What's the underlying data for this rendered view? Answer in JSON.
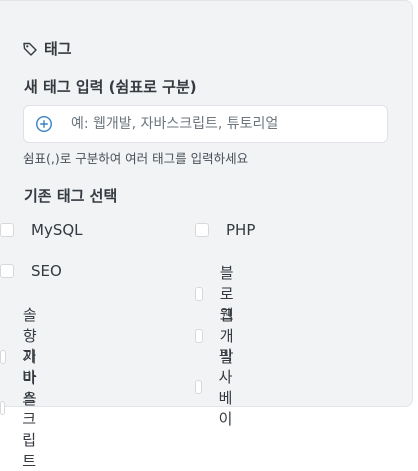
{
  "panel": {
    "title": "태그",
    "title_icon": "tag-icon"
  },
  "new_tag": {
    "label": "새 태그 입력 (쉼표로 구분)",
    "placeholder": "예: 웹개발, 자바스크립트, 튜토리얼",
    "value": "",
    "add_icon": "plus-circle-icon",
    "help": "쉼표(,)로 구분하여 여러 태그를 입력하세요"
  },
  "existing": {
    "label": "기존 태그 선택",
    "tags": [
      {
        "label": "MySQL",
        "checked": false
      },
      {
        "label": "PHP",
        "checked": false
      },
      {
        "label": "SEO",
        "checked": false
      },
      {
        "label": "블로그",
        "checked": false
      },
      {
        "label": "솔향기마을",
        "checked": false
      },
      {
        "label": "웹개발",
        "checked": false
      },
      {
        "label": "자바스크립트",
        "checked": false
      },
      {
        "label": "픽사베이",
        "checked": false
      }
    ]
  },
  "colors": {
    "panel_bg": "#f1f3f5",
    "accent": "#3b82c4"
  }
}
